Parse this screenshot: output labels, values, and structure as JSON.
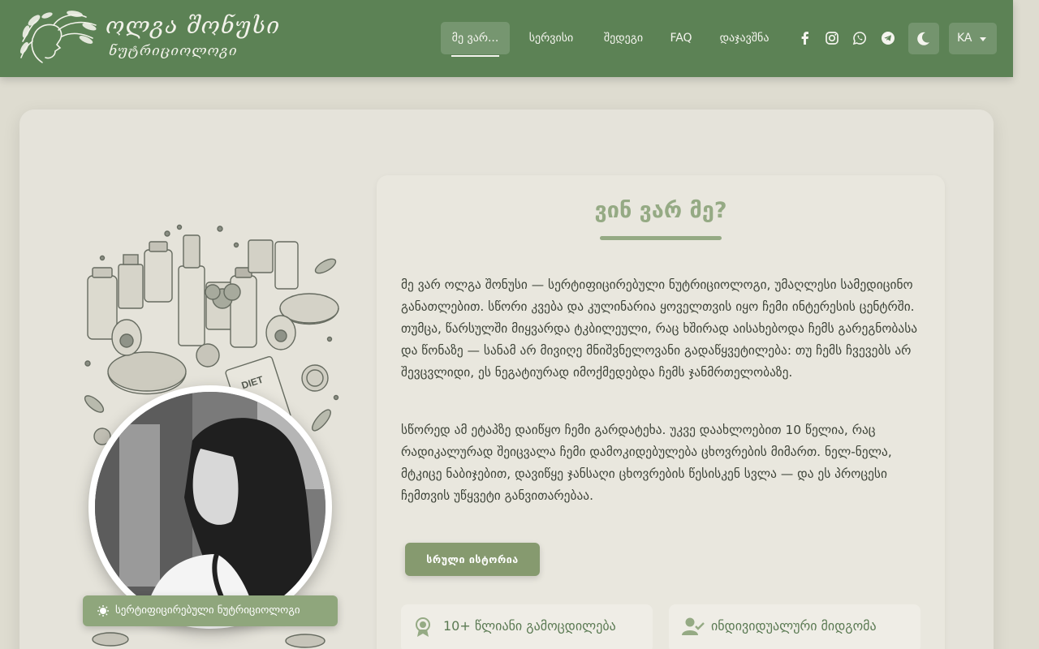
{
  "brand": {
    "name": "ოლგა შონუსი",
    "subtitle": "ნუტრიციოლოგი"
  },
  "nav": {
    "items": [
      {
        "label": "მე ვარ...",
        "active": true
      },
      {
        "label": "სერვისი",
        "active": false
      },
      {
        "label": "შედეგი",
        "active": false
      },
      {
        "label": "FAQ",
        "active": false
      },
      {
        "label": "დაჯავშნა",
        "active": false
      }
    ],
    "social_icons": [
      "facebook-icon",
      "instagram-icon",
      "whatsapp-icon",
      "telegram-icon"
    ],
    "theme_icon": "moon-icon",
    "language": "KA"
  },
  "colors": {
    "nav_green": "#5c8255",
    "accent": "#95aa84",
    "button": "#869a6f",
    "background": "#dedcd0"
  },
  "about": {
    "title": "ვინ ვარ მე?",
    "paragraphs": [
      "მე ვარ ოლგა შონუსი — სერტიფიცირებული ნუტრიციოლოგი, უმაღლესი სამედიცინო განათლებით. სწორი კვება და კულინარია ყოველთვის იყო ჩემი ინტერესის ცენტრში. თუმცა, წარსულში მიყვარდა ტკბილეული, რაც ხშირად აისახებოდა ჩემს გარეგნობასა და წონაზე — სანამ არ მივიღე მნიშვნელოვანი გადაწყვეტილება: თუ ჩემს ჩვევებს არ შევცვლიდი, ეს ნეგატიურად იმოქმედებდა ჩემს ჯანმრთელობაზე.",
      "სწორედ ამ ეტაპზე დაიწყო ჩემი გარდატეხა. უკვე დაახლოებით 10 წელია, რაც რადიკალურად შეიცვალა ჩემი დამოკიდებულება ცხოვრების მიმართ. ნელ-ნელა, მტკიცე ნაბიჯებით, დავიწყე ჯანსაღი ცხოვრების წესისკენ სვლა — და ეს პროცესი ჩემთვის უწყვეტი განვითარებაა."
    ],
    "button": "სრული ისტორია",
    "features": [
      {
        "icon": "award-icon",
        "label": "10+ წლიანი გამოცდილება"
      },
      {
        "icon": "user-check-icon",
        "label": "ინდივიდუალური მიდგომა"
      }
    ]
  },
  "portrait": {
    "badge": "სერტიფიცირებული ნუტრიციოლოგი",
    "badge_icon": "sun-icon"
  }
}
